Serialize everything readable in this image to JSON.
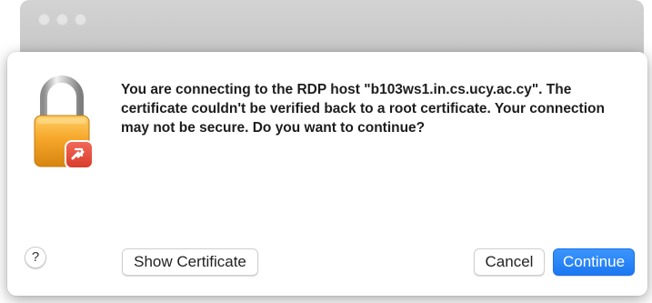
{
  "dialog": {
    "message": "You are connecting to the RDP host \"b103ws1.in.cs.ucy.ac.cy\". The certificate couldn't be verified back to a root certificate. Your connection may not be secure. Do you want to continue?",
    "help_label": "?",
    "show_certificate_label": "Show Certificate",
    "cancel_label": "Cancel",
    "continue_label": "Continue",
    "icon": "padlock-remote-desktop-icon"
  },
  "colors": {
    "accent": "#1b77f2",
    "lock_body": "#f0a020",
    "badge": "#e84c3d"
  }
}
